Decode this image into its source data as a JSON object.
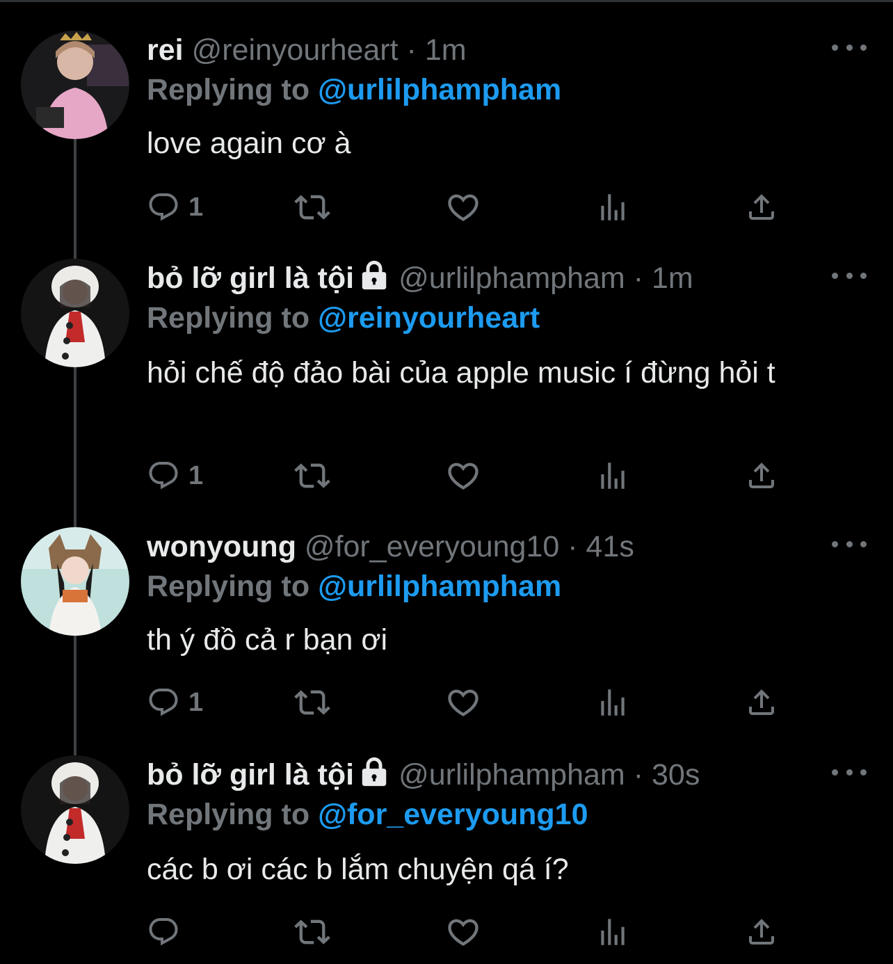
{
  "tweets": [
    {
      "name": "rei",
      "handle": "@reinyourheart",
      "time": "1m",
      "locked": false,
      "reply_label": "Replying to",
      "reply_to": "@urlilphampham",
      "text": "love again cơ à",
      "reply_count": "1"
    },
    {
      "name": "bỏ lỡ girl là tội",
      "handle": "@urlilphampham",
      "time": "1m",
      "locked": true,
      "reply_label": "Replying to",
      "reply_to": "@reinyourheart",
      "text": "hỏi chế độ đảo bài của apple music í đừng hỏi t",
      "reply_count": "1"
    },
    {
      "name": "wonyoung",
      "handle": "@for_everyoung10",
      "time": "41s",
      "locked": false,
      "reply_label": "Replying to",
      "reply_to": "@urlilphampham",
      "text": "th ý đồ cả r bạn ơi",
      "reply_count": "1"
    },
    {
      "name": "bỏ lỡ girl là tội",
      "handle": "@urlilphampham",
      "time": "30s",
      "locked": true,
      "reply_label": "Replying to",
      "reply_to": "@for_everyoung10",
      "text": "các b ơi các b lắm chuyện qá í?",
      "reply_count": ""
    }
  ],
  "separator": "·",
  "icons": {
    "reply": "reply-icon",
    "retweet": "retweet-icon",
    "like": "like-icon",
    "views": "views-icon",
    "share": "share-icon",
    "more": "more-icon",
    "lock": "lock-icon"
  },
  "colors": {
    "background": "#000000",
    "text": "#e7e9ea",
    "secondary": "#71767b",
    "link": "#1d9bf0"
  }
}
